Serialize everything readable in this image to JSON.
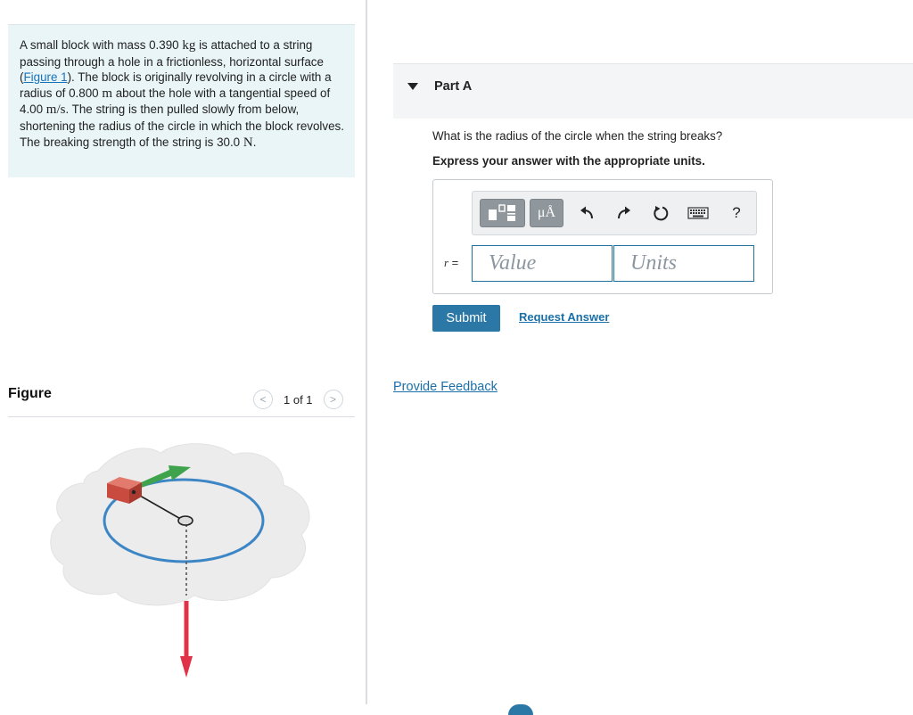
{
  "problem": {
    "text_1": "A small block with mass 0.390 ",
    "unit_kg": "kg",
    "text_2": " is attached to a string passing through a hole in a frictionless, horizontal surface (",
    "figure_link": "Figure 1",
    "text_3": "). The block is originally revolving in a circle with a radius of 0.800 ",
    "unit_m": "m",
    "text_4": " about the hole with a tangential speed of 4.00 ",
    "unit_ms": "m/s",
    "text_5": ". The string is then pulled slowly from below, shortening the radius of the circle in which the block revolves. The breaking strength of the string is 30.0 ",
    "unit_N": "N",
    "text_6": "."
  },
  "figure": {
    "label": "Figure",
    "pager": {
      "prev": "<",
      "count": "1 of 1",
      "next": ">"
    }
  },
  "part": {
    "caret_icon": "caret-down-icon",
    "title": "Part A",
    "question": "What is the radius of the circle when the string breaks?",
    "instruction": "Express your answer with the appropriate units.",
    "toolbar": {
      "icons": [
        "templates-icon",
        "units-icon",
        "undo-icon",
        "redo-icon",
        "reset-icon",
        "keyboard-icon",
        "help-icon"
      ],
      "units_label": "μÅ",
      "help_label": "?"
    },
    "variable": "r",
    "equals": " =",
    "value_placeholder": "Value",
    "units_placeholder": "Units",
    "submit_label": "Submit",
    "request_label": "Request Answer"
  },
  "feedback_label": "Provide Feedback",
  "colors": {
    "accent": "#2b77a6",
    "link": "#1a6fa8",
    "problem_bg": "#e9f5f7",
    "block": "#c94a3f",
    "orbit": "#3d86c6",
    "velocity_arrow": "#3fa34d",
    "force_arrow": "#e03347"
  }
}
